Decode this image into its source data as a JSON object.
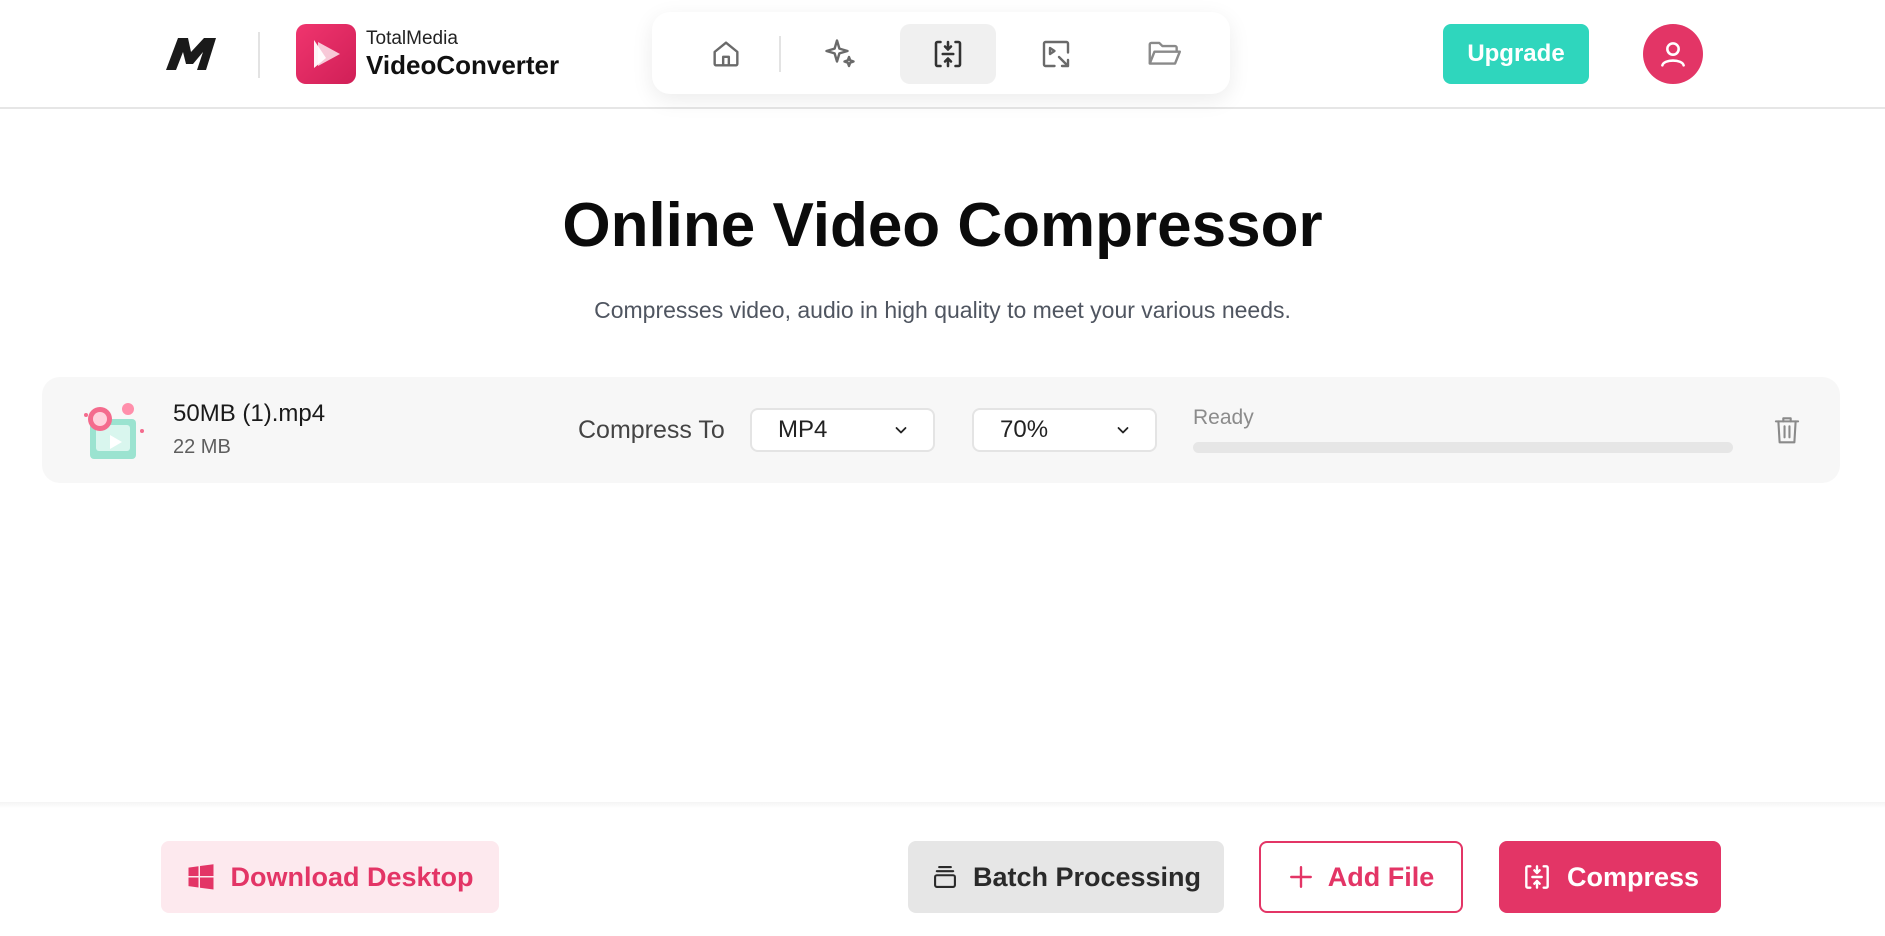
{
  "colors": {
    "accent": "#e33566",
    "upgrade": "#2fd6bd",
    "row_bg": "#f7f7f7",
    "text_dark": "#0b0b0b",
    "text_muted": "#4f5560"
  },
  "header": {
    "brand_icon": "totalmedia-m-logo",
    "app_name_top": "TotalMedia",
    "app_name_bottom": "VideoConverter",
    "nav": [
      {
        "icon": "home-icon",
        "active": false
      },
      {
        "icon": "sparkle-ai-icon",
        "active": false
      },
      {
        "icon": "compress-icon",
        "active": true
      },
      {
        "icon": "image-convert-icon",
        "active": false
      },
      {
        "icon": "folder-icon",
        "active": false
      }
    ],
    "upgrade_label": "Upgrade",
    "avatar_icon": "user-icon"
  },
  "main": {
    "title": "Online Video Compressor",
    "subtitle": "Compresses video, audio in high quality to meet your various needs."
  },
  "file": {
    "name": "50MB (1).mp4",
    "size": "22 MB",
    "compress_label": "Compress To",
    "format_selected": "MP4",
    "ratio_selected": "70%",
    "status": "Ready",
    "progress": 0
  },
  "bottom": {
    "download_label": "Download Desktop",
    "batch_label": "Batch Processing",
    "add_label": "Add File",
    "compress_label": "Compress"
  }
}
